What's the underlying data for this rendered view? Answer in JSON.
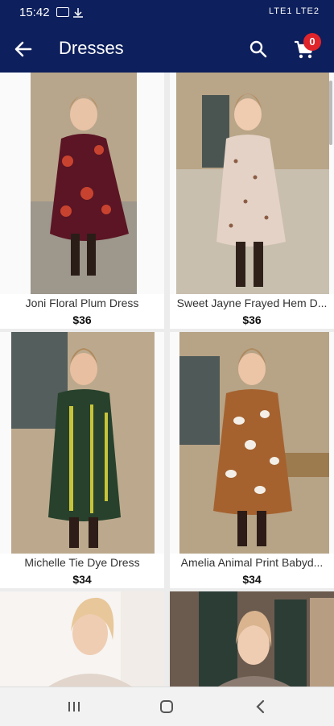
{
  "status_bar": {
    "time": "15:42",
    "right_text": "LTE1 LTE2"
  },
  "app_bar": {
    "title": "Dresses",
    "cart_count": "0"
  },
  "products": [
    {
      "name": "Joni Floral Plum Dress",
      "price": "$36",
      "dress_color": "#5b1524",
      "accent_color": "#c8432f"
    },
    {
      "name": "Sweet Jayne Frayed Hem D...",
      "price": "$36",
      "dress_color": "#e4d2c6",
      "accent_color": "#8c5d45"
    },
    {
      "name": "Michelle Tie Dye Dress",
      "price": "$34",
      "dress_color": "#27412c",
      "accent_color": "#c8c43a"
    },
    {
      "name": "Amelia Animal Print Babyd...",
      "price": "$34",
      "dress_color": "#a5622f",
      "accent_color": "#f3efe8"
    },
    {
      "name": "",
      "price": "",
      "dress_color": "#f1ece7",
      "accent_color": "#e8c79a"
    },
    {
      "name": "",
      "price": "",
      "dress_color": "#2c3d36",
      "accent_color": "#d9b48f"
    }
  ],
  "colors": {
    "header": "#0d1f5c",
    "badge": "#e0242b"
  },
  "icons": [
    "back-arrow-icon",
    "search-icon",
    "cart-icon",
    "recents-icon",
    "home-icon",
    "back-nav-icon"
  ]
}
